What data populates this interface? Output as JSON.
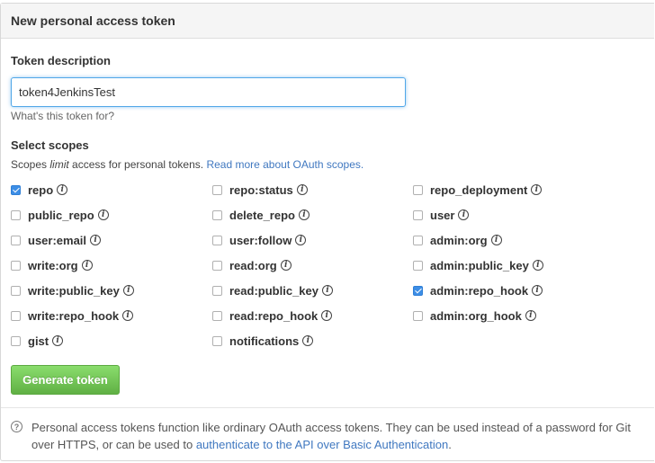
{
  "header": {
    "title": "New personal access token"
  },
  "description": {
    "label": "Token description",
    "value": "token4JenkinsTest",
    "hint": "What's this token for?"
  },
  "scopes": {
    "label": "Select scopes",
    "intro_before": "Scopes ",
    "intro_em": "limit",
    "intro_after": " access for personal tokens. ",
    "intro_link": "Read more about OAuth scopes.",
    "items": [
      {
        "name": "repo",
        "checked": true
      },
      {
        "name": "repo:status",
        "checked": false
      },
      {
        "name": "repo_deployment",
        "checked": false
      },
      {
        "name": "public_repo",
        "checked": false
      },
      {
        "name": "delete_repo",
        "checked": false
      },
      {
        "name": "user",
        "checked": false
      },
      {
        "name": "user:email",
        "checked": false
      },
      {
        "name": "user:follow",
        "checked": false
      },
      {
        "name": "admin:org",
        "checked": false
      },
      {
        "name": "write:org",
        "checked": false
      },
      {
        "name": "read:org",
        "checked": false
      },
      {
        "name": "admin:public_key",
        "checked": false
      },
      {
        "name": "write:public_key",
        "checked": false
      },
      {
        "name": "read:public_key",
        "checked": false
      },
      {
        "name": "admin:repo_hook",
        "checked": true
      },
      {
        "name": "write:repo_hook",
        "checked": false
      },
      {
        "name": "read:repo_hook",
        "checked": false
      },
      {
        "name": "admin:org_hook",
        "checked": false
      },
      {
        "name": "gist",
        "checked": false
      },
      {
        "name": "notifications",
        "checked": false
      }
    ]
  },
  "generate_button": "Generate token",
  "help": {
    "icon": "question-circle-icon",
    "text": "Personal access tokens function like ordinary OAuth access tokens. They can be used instead of a password for Git over HTTPS, or can be used to ",
    "link": "authenticate to the API over Basic Authentication",
    "end": "."
  },
  "colors": {
    "accent": "#4078c0",
    "button": "#60b044",
    "checked": "#3d8ee6"
  }
}
